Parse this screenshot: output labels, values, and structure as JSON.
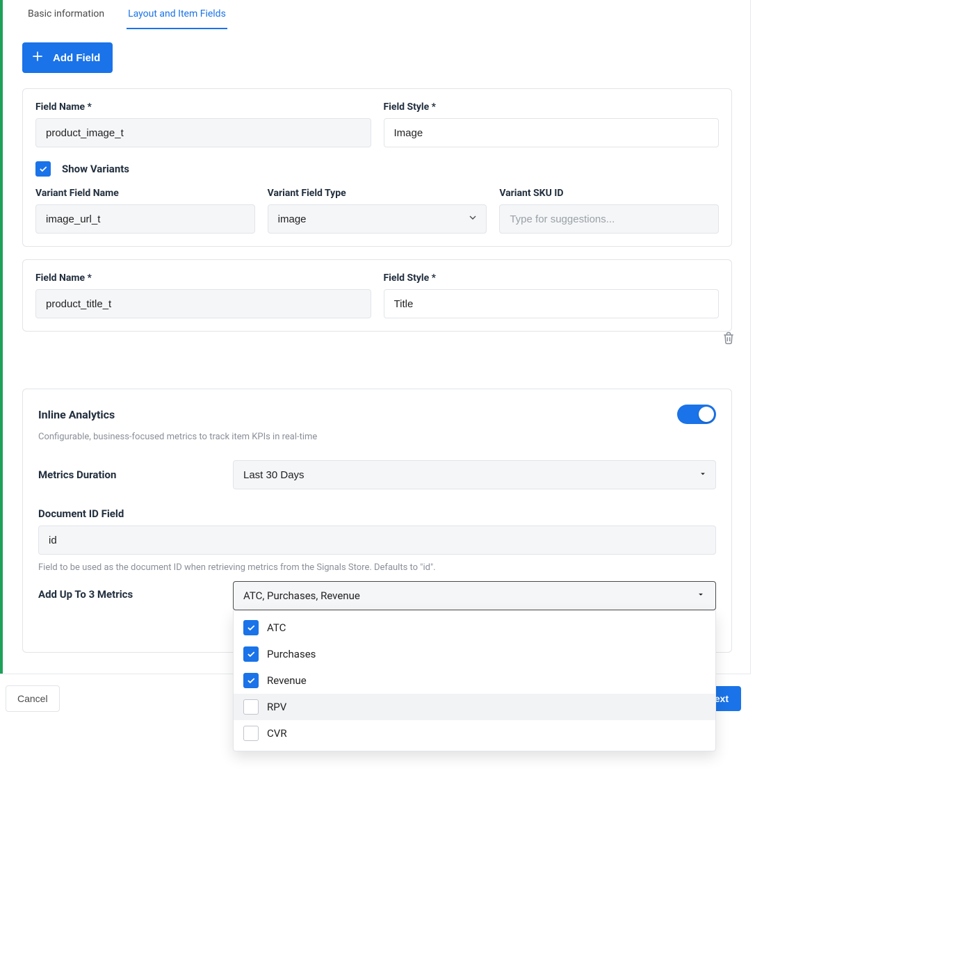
{
  "tabs": {
    "basic": "Basic information",
    "layout": "Layout and Item Fields"
  },
  "add_field_label": "Add Field",
  "card1": {
    "field_name_label": "Field Name *",
    "field_name_value": "product_image_t",
    "field_style_label": "Field Style *",
    "field_style_value": "Image",
    "show_variants_label": "Show Variants",
    "variant_field_name_label": "Variant Field Name",
    "variant_field_name_value": "image_url_t",
    "variant_field_type_label": "Variant Field Type",
    "variant_field_type_value": "image",
    "variant_sku_label": "Variant SKU ID",
    "variant_sku_placeholder": "Type for suggestions..."
  },
  "card2": {
    "field_name_label": "Field Name *",
    "field_name_value": "product_title_t",
    "field_style_label": "Field Style *",
    "field_style_value": "Title"
  },
  "analytics": {
    "title": "Inline Analytics",
    "subtitle": "Configurable, business-focused metrics to track item KPIs in real-time",
    "metrics_duration_label": "Metrics Duration",
    "metrics_duration_value": "Last 30 Days",
    "doc_id_label": "Document ID Field",
    "doc_id_value": "id",
    "doc_id_help": "Field to be used as the document ID when retrieving metrics from the Signals Store. Defaults to \"id\".",
    "add_metrics_label": "Add Up To 3 Metrics",
    "add_metrics_value": "ATC, Purchases, Revenue",
    "options": [
      {
        "label": "ATC",
        "checked": true,
        "highlight": false
      },
      {
        "label": "Purchases",
        "checked": true,
        "highlight": false
      },
      {
        "label": "Revenue",
        "checked": true,
        "highlight": false
      },
      {
        "label": "RPV",
        "checked": false,
        "highlight": true
      },
      {
        "label": "CVR",
        "checked": false,
        "highlight": false
      }
    ]
  },
  "footer": {
    "cancel": "Cancel",
    "next": "Next"
  }
}
